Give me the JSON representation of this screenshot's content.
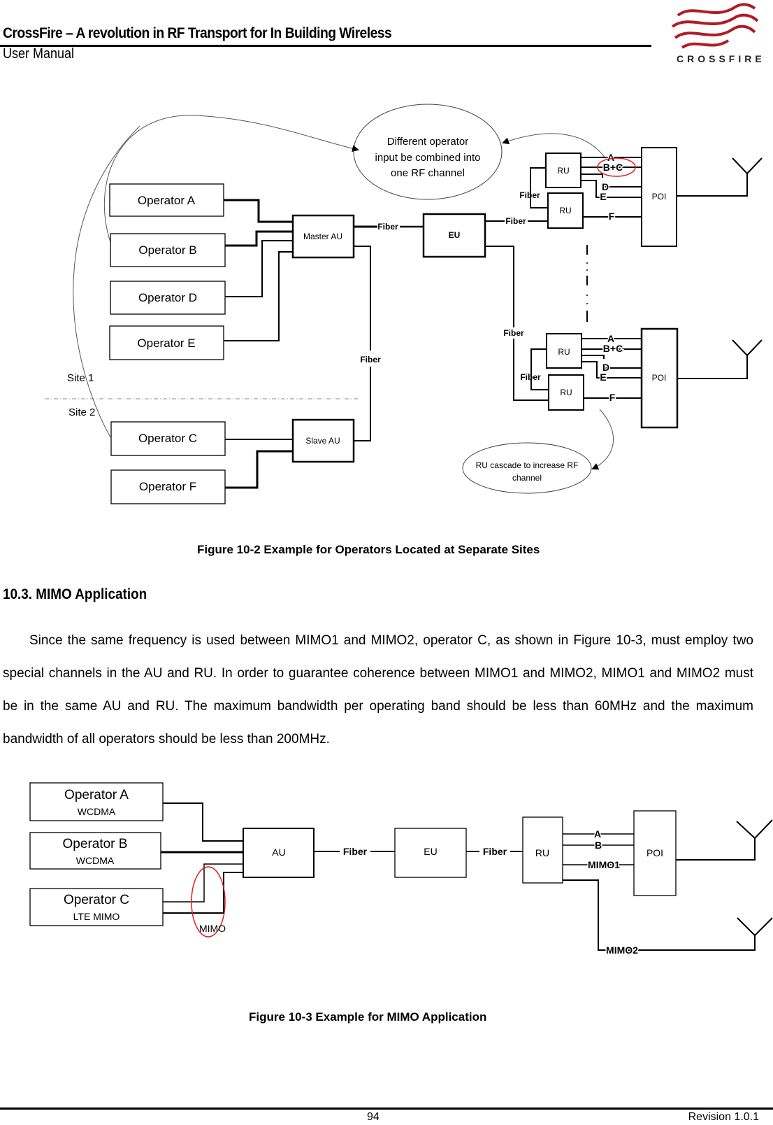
{
  "header": {
    "title": "CrossFire – A revolution in RF Transport for In Building Wireless",
    "subtitle": "User Manual",
    "logo_text": "CROSSFIRE",
    "logo_color": "#b01c24"
  },
  "figure1": {
    "callout_top": [
      "Different operator",
      "input be combined into",
      "one RF channel"
    ],
    "callout_bottom": [
      "RU cascade to increase RF",
      "channel"
    ],
    "operators": [
      "Operator A",
      "Operator B",
      "Operator D",
      "Operator E",
      "Operator C",
      "Operator F"
    ],
    "master_au": "Master AU",
    "slave_au": "Slave AU",
    "eu": "EU",
    "ru": "RU",
    "poi": "POI",
    "fiber": "Fiber",
    "site1": "Site 1",
    "site2": "Site 2",
    "channels": [
      "A",
      "B+C",
      "D",
      "E",
      "F"
    ],
    "highlight_color": "#e02020",
    "caption": "Figure 10-2 Example for Operators Located at Separate Sites"
  },
  "section": {
    "heading": "10.3.  MIMO Application",
    "paragraph": "Since the same frequency is used between MIMO1 and MIMO2, operator C, as shown in Figure 10-3, must employ two special channels in the AU and RU. In order to guarantee coherence between MIMO1 and MIMO2, MIMO1 and MIMO2 must be in the same AU and RU. The maximum bandwidth per operating band should be less than 60MHz and the maximum bandwidth of all operators should be less than 200MHz."
  },
  "figure2": {
    "operators": [
      {
        "name": "Operator A",
        "tech": "WCDMA"
      },
      {
        "name": "Operator B",
        "tech": "WCDMA"
      },
      {
        "name": "Operator C",
        "tech": "LTE MIMO"
      }
    ],
    "au": "AU",
    "eu": "EU",
    "ru": "RU",
    "poi": "POI",
    "fiber": "Fiber",
    "mimo": "MIMO",
    "channels": [
      "A",
      "B",
      "MIMO1"
    ],
    "mimo2": "MIMO2",
    "caption": "Figure 10-3 Example for MIMO Application"
  },
  "footer": {
    "page": "94",
    "revision": "Revision 1.0.1"
  }
}
